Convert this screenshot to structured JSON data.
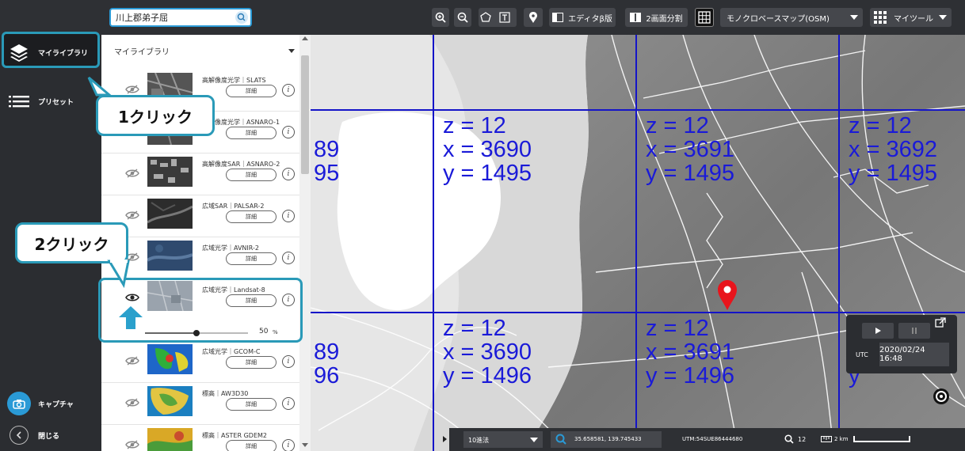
{
  "search": {
    "value": "川上郡弟子屈"
  },
  "toolbar": {
    "editor_label": "エディタβ版",
    "split_label": "2画面分割",
    "basemap_label": "モノクロベースマップ(OSM)",
    "mytools_label": "マイツール"
  },
  "rail": {
    "mylibrary_label": "マイライブラリ",
    "preset_label": "プリセット",
    "capture_label": "キャプチャ",
    "close_label": "閉じる"
  },
  "panel": {
    "title": "マイライブラリ",
    "detail_label": "詳細",
    "layers": [
      {
        "name": "高解像度光学｜SLATS"
      },
      {
        "name": "高解像度光学｜ASNARO-1"
      },
      {
        "name": "高解像度SAR｜ASNARO-2"
      },
      {
        "name": "広域SAR｜PALSAR-2"
      },
      {
        "name": "広域光学｜AVNIR-2"
      },
      {
        "name": "広域光学｜Landsat-8",
        "opacity": "50",
        "opacity_unit": "%",
        "opacity_fraction": 0.5
      },
      {
        "name": "広域光学｜GCOM-C"
      },
      {
        "name": "標高｜AW3D30"
      },
      {
        "name": "標高｜ASTER GDEM2"
      }
    ]
  },
  "callouts": {
    "first": "1クリック",
    "second": "2クリック"
  },
  "tiles": [
    {
      "z": "z = 12",
      "x": "x = 3690",
      "y": "y = 1495"
    },
    {
      "z": "z = 12",
      "x": "x = 3691",
      "y": "y = 1495"
    },
    {
      "z": "z = 12",
      "x": "x = 3692",
      "y": "y = 1495"
    },
    {
      "z": "z = 12",
      "x": "x = 3690",
      "y": "y = 1496"
    },
    {
      "z": "z = 12",
      "x": "x = 3691",
      "y": "y = 1496"
    }
  ],
  "partial_tiles": {
    "top_x": "89",
    "top_y": "95",
    "bottom_x": "89",
    "bottom_y": "96",
    "bottom_right_y": "y"
  },
  "bottombar": {
    "coord_format": "10進法",
    "coordinates": "35.658581, 139.745433",
    "utm": "UTM:54SUE86444680",
    "zoom": "12",
    "scale": "2 km"
  },
  "playback": {
    "timezone": "UTC",
    "datetime": "2020/02/24 16:48"
  },
  "colors": {
    "accent": "#2a9ab8",
    "grid": "#1010d0",
    "marker": "#e8141c"
  }
}
